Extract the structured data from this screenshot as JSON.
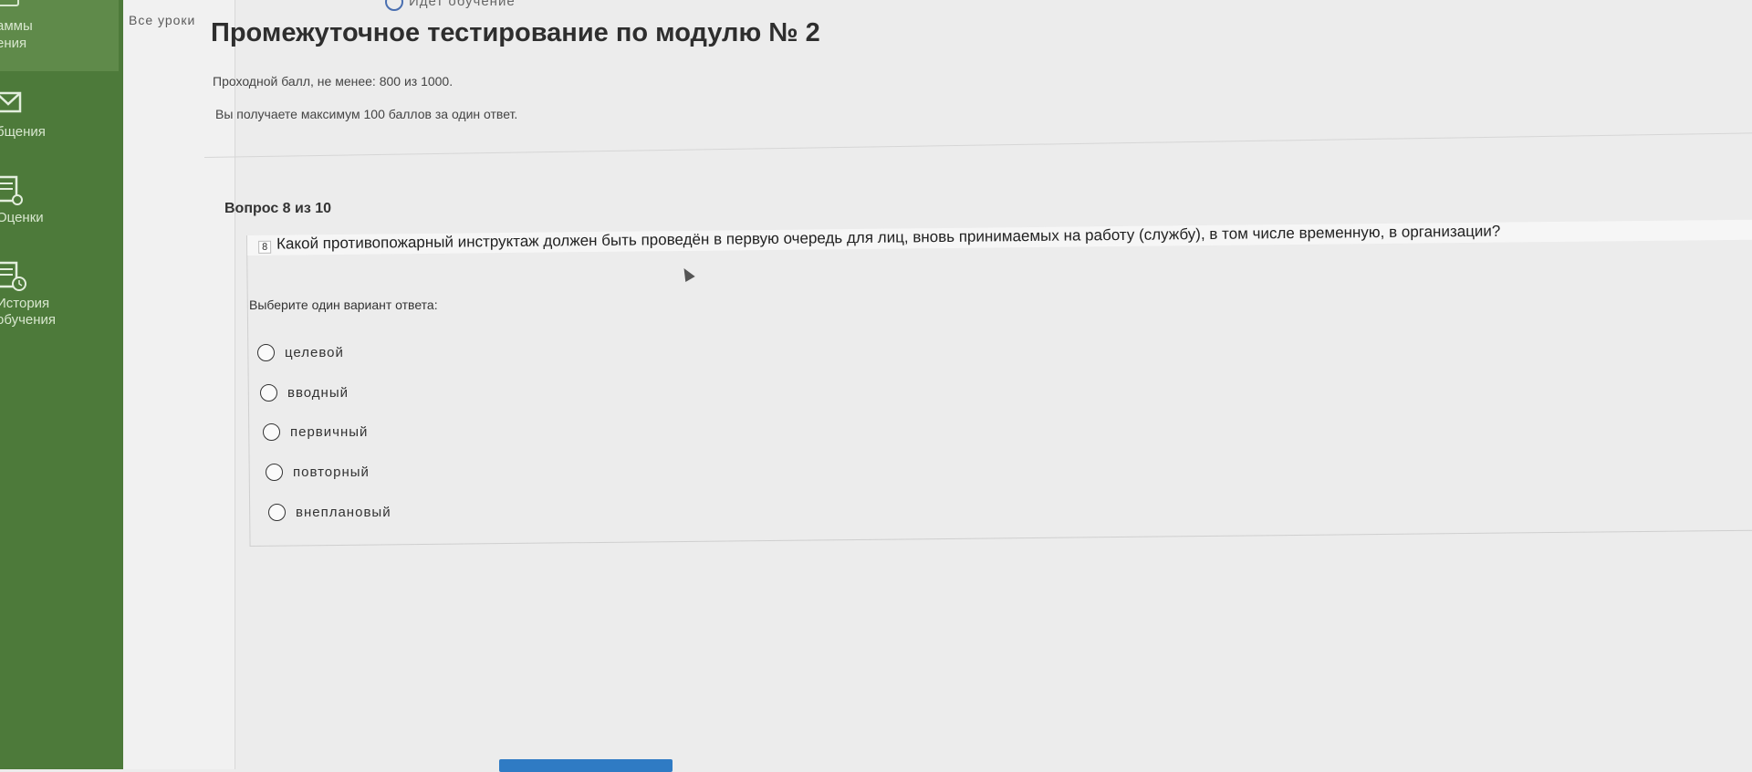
{
  "sidebar": {
    "items": [
      {
        "label": "аммы",
        "icon": "programs-icon"
      },
      {
        "label": "ения",
        "icon": ""
      },
      {
        "label": "бщения",
        "icon": "mail-icon"
      },
      {
        "label": "Оценки",
        "icon": "grades-icon"
      },
      {
        "label": "История",
        "label2": "обучения",
        "icon": "history-icon"
      }
    ]
  },
  "submenu": {
    "all_lessons": "Все уроки"
  },
  "status": {
    "text": "Идет обучение"
  },
  "test": {
    "title": "Промежуточное тестирование по модулю № 2",
    "passing_score": "Проходной балл, не менее: 800 из 1000.",
    "points_info": "Вы получаете максимум 100 баллов за один ответ."
  },
  "question": {
    "counter": "Вопрос 8 из 10",
    "number": "8",
    "text": "Какой противопожарный инструктаж должен быть проведён в первую очередь для лиц, вновь принимаемых на работу (службу), в том числе временную, в организации?",
    "instruction": "Выберите один вариант ответа:",
    "options": [
      "целевой",
      "вводный",
      "первичный",
      "повторный",
      "внеплановый"
    ],
    "selected": null
  },
  "colors": {
    "sidebar": "#4d7a3a",
    "accent": "#2f7bc4"
  }
}
